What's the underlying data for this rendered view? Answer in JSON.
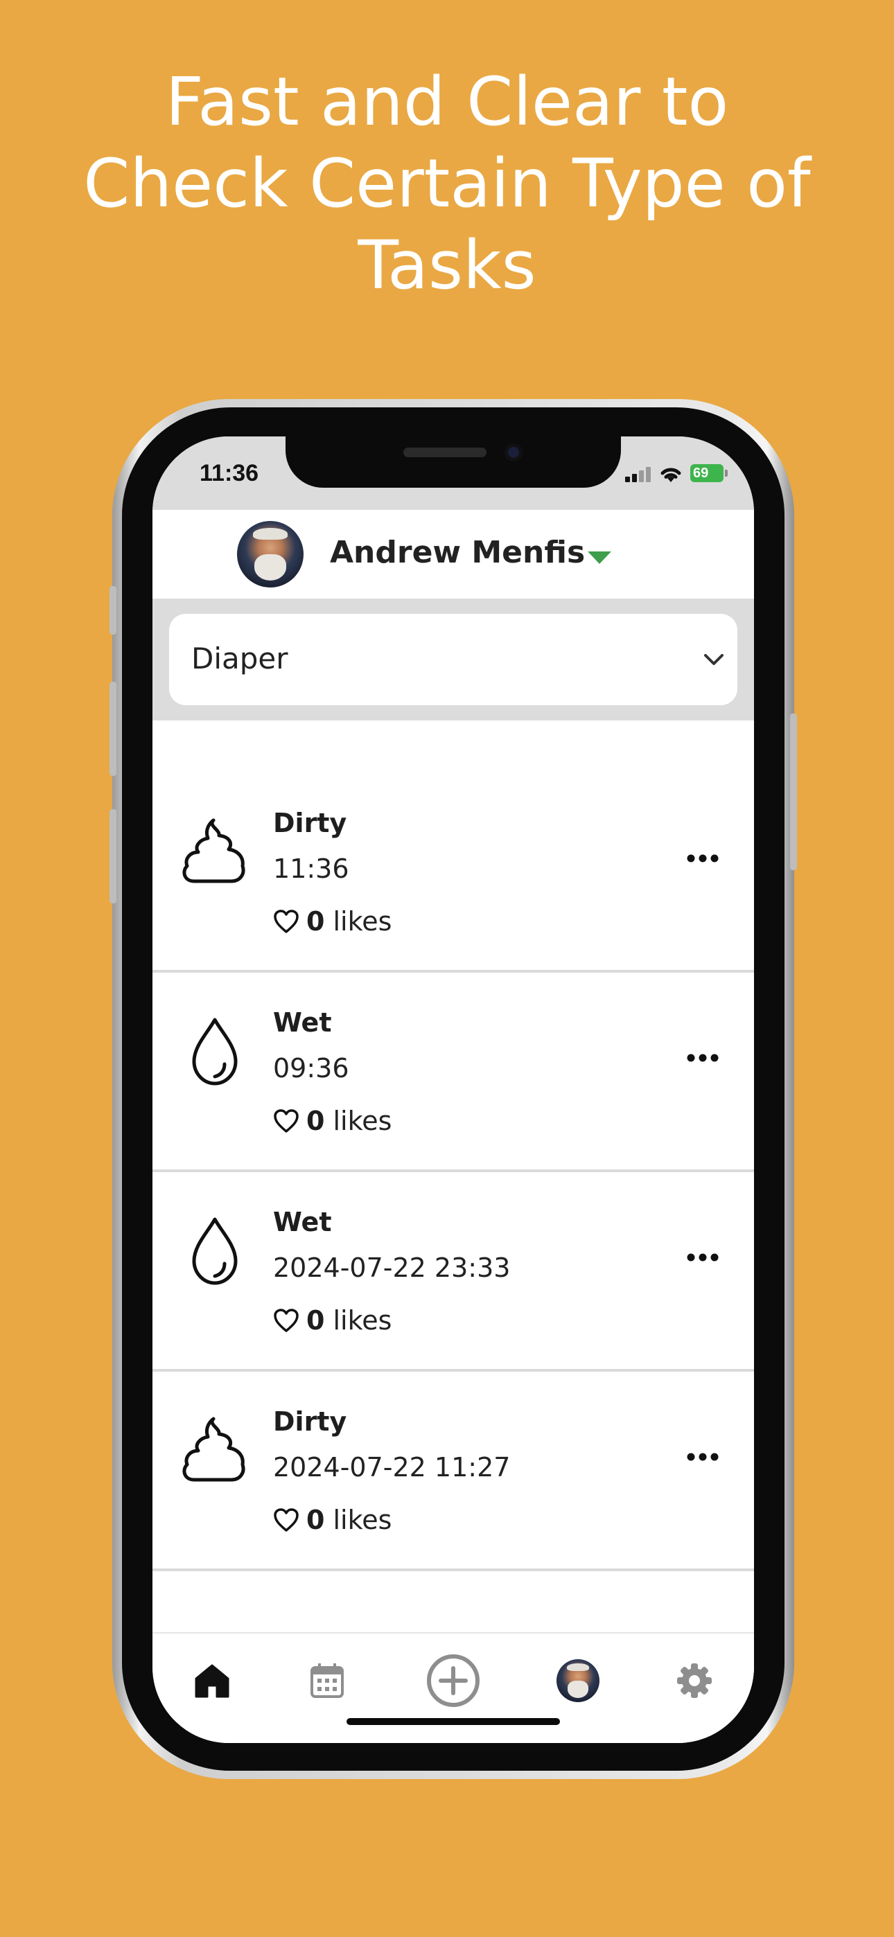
{
  "headline": {
    "lines": [
      "Fast and Clear to",
      "Check Certain Type of",
      "Tasks"
    ]
  },
  "status_bar": {
    "time": "11:36",
    "battery": "69"
  },
  "header": {
    "user_name": "Andrew Menfis",
    "avatar_icon": "user-avatar",
    "dropdown_icon": "caret-down-icon",
    "accent_color": "#3F9E4C"
  },
  "filter": {
    "selected": "Diaper",
    "icon": "chevron-down-icon"
  },
  "entries": [
    {
      "type": "Dirty",
      "time": "11:36",
      "likes_count": "0",
      "likes_label": "likes",
      "icon": "poop-icon"
    },
    {
      "type": "Wet",
      "time": "09:36",
      "likes_count": "0",
      "likes_label": "likes",
      "icon": "water-drop-icon"
    },
    {
      "type": "Wet",
      "time": "2024-07-22 23:33",
      "likes_count": "0",
      "likes_label": "likes",
      "icon": "water-drop-icon"
    },
    {
      "type": "Dirty",
      "time": "2024-07-22 11:27",
      "likes_count": "0",
      "likes_label": "likes",
      "icon": "poop-icon"
    }
  ],
  "tabbar": {
    "items": [
      {
        "icon": "home-icon",
        "active": true
      },
      {
        "icon": "calendar-icon",
        "active": false
      },
      {
        "icon": "add-circle-icon",
        "active": false
      },
      {
        "icon": "profile-avatar",
        "active": false
      },
      {
        "icon": "gear-icon",
        "active": false
      }
    ]
  },
  "colors": {
    "background": "#E9A843",
    "band": "#DCDCDC",
    "battery": "#3EB44D"
  }
}
